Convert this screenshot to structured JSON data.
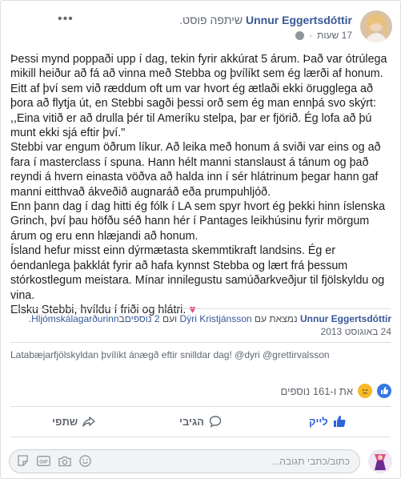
{
  "header": {
    "author": "Unnur Eggertsdóttir",
    "action": "שיתפה פוסט.",
    "time": "17 שעות",
    "privacy_icon": "globe-icon",
    "menu_icon": "more-icon"
  },
  "post": {
    "paragraphs": [
      "Þessi mynd poppaði upp í dag, tekin fyrir akkúrat 5 árum. Það var ótrúlega mikill heiður að fá að vinna með Stebba og þvílíkt sem ég lærði af honum.",
      "Eitt af því sem við ræddum oft um var hvort ég ætlaði ekki örugglega að þora að flytja út, en Stebbi sagði þessi orð sem ég man ennþá svo skýrt: ,,Eina vitið er að drulla þér til Ameríku stelpa, þar er fjörið. Ég lofa að þú munt ekki sjá eftir því.\"",
      "Stebbi var engum öðrum líkur. Að leika með honum á sviði var eins og að fara í masterclass í spuna. Hann hélt manni stanslaust á tánum og það reyndi á hvern einasta vöðva að halda inn í sér hlátrinum þegar hann gaf manni eitthvað ákveðið augnaráð eða prumpuhljóð.",
      "Enn þann dag í dag hitti ég fólk í LA sem spyr hvort ég þekki hinn íslenska Grinch, því þau höfðu séð hann hér í Pantages leikhúsinu fyrir mörgum árum og eru enn hlæjandi að honum.",
      "Ísland hefur misst einn dýrmætasta skemmtikraft landsins. Ég er óendanlega þakklát fyrir að hafa kynnst Stebba og lært frá þessum stórkostlegum meistara. Mínar innilegustu samúðarkveðjur til fjölskyldu og vina.",
      "Elsku Stebbi, hvíldu í friði og hlátri."
    ],
    "heart": "♥"
  },
  "shared": {
    "author": "Unnur Eggertsdóttir",
    "tagged_prefix": "נמצאת עם",
    "tagged_person": "Dýri Kristjánsson",
    "tagged_and": "ועם",
    "tagged_others": "2 נוספים",
    "location_prefix": "ב",
    "location": "Hljómskálagarðurinn",
    "date": "24 באוגוסט 2013",
    "caption": "Latabæjarfjölskyldan þvílíkt ánægð eftir snilldar dag! @dyri @grettirvalsson"
  },
  "reactions": {
    "summary": "את ו-161 נוספים",
    "icons": [
      "like-reaction-icon",
      "sad-reaction-icon"
    ]
  },
  "actions": {
    "like": "לייק",
    "comment": "הגיבי",
    "share": "שתפי"
  },
  "comment_box": {
    "placeholder": "כתוב/כתבי תגובה..."
  },
  "colors": {
    "link": "#385898",
    "liked": "#2d64d9",
    "heart": "#e8457a"
  }
}
